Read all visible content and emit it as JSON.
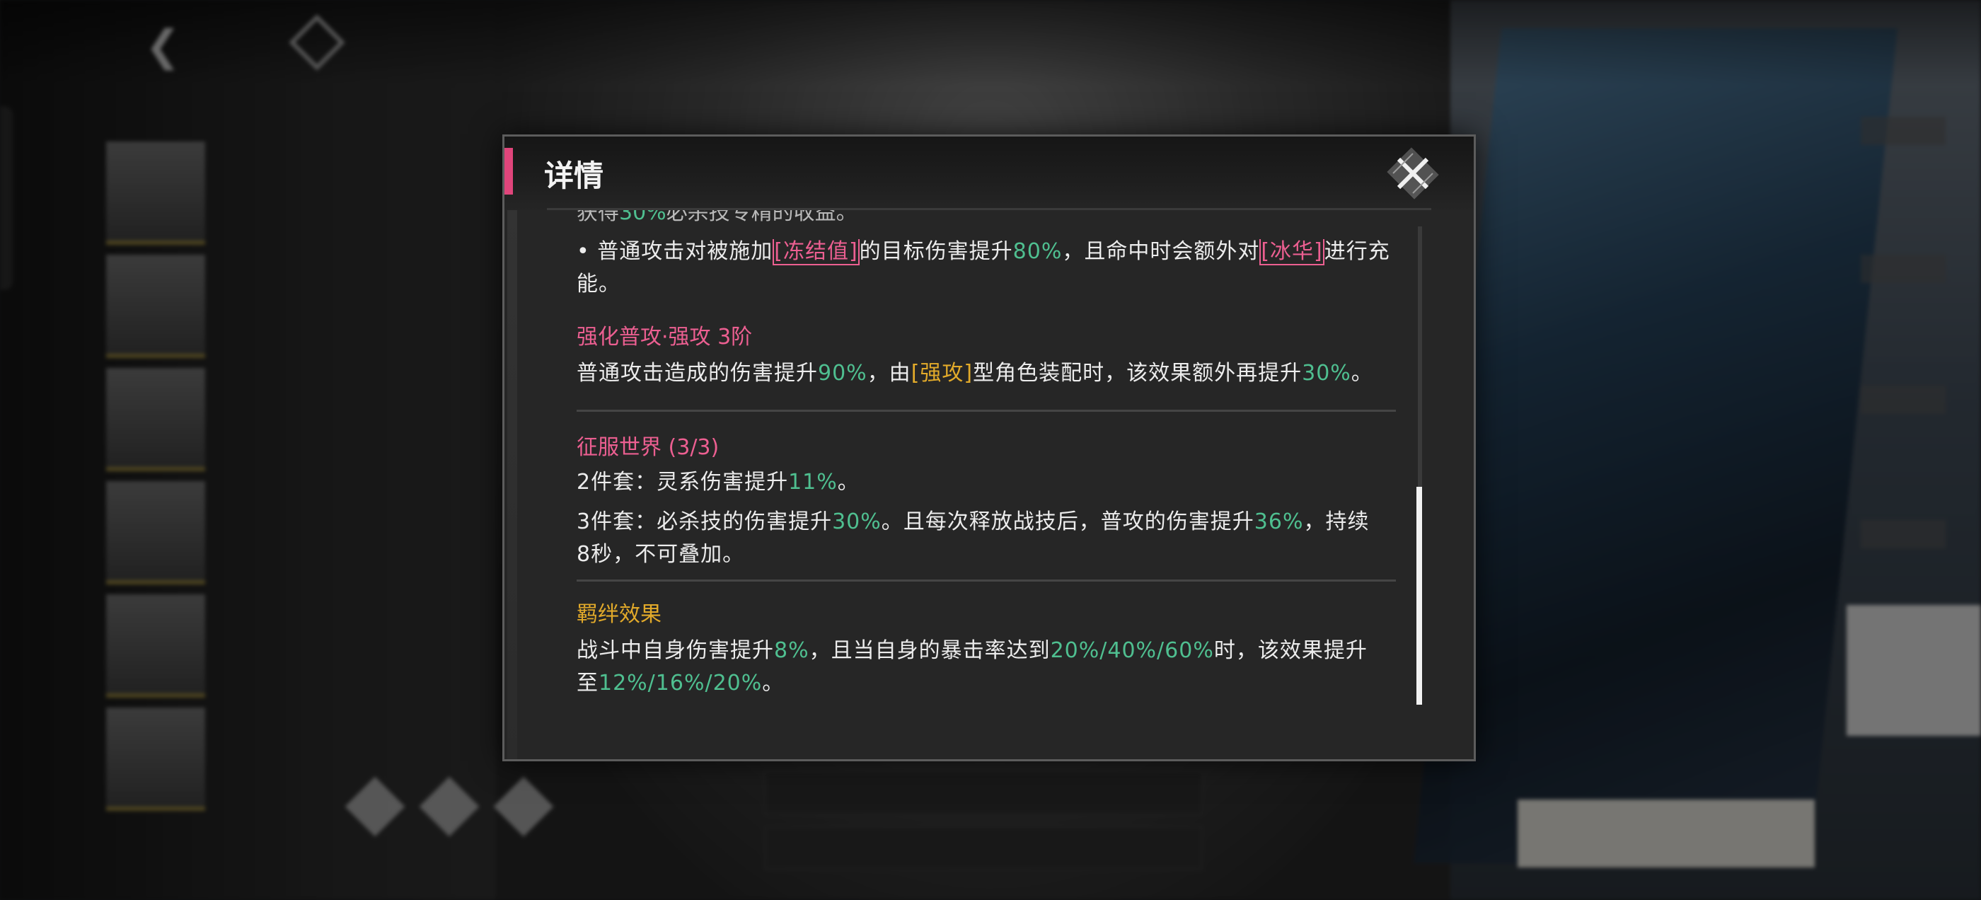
{
  "modal": {
    "title": "详情",
    "top_clipped_line": {
      "prefix": "获得",
      "value": "30%",
      "suffix": "必杀技专精的收益。"
    },
    "bullet_line": {
      "p1": "• 普通攻击对被施加",
      "tag1": "[冻结值]",
      "p2": "的目标伤害提升",
      "value": "80%",
      "p3": "，且命中时会额外对",
      "tag2": "[冰华]",
      "p4": "进行充",
      "p5": "能。"
    },
    "enhance": {
      "title": "强化普攻·强攻 3阶",
      "p1": "普通攻击造成的伤害提升",
      "v1": "90%",
      "p2": "，由",
      "tag": "[强攻]",
      "p3": "型角色装配时，该效果额外再提升",
      "v2": "30%",
      "p4": "。"
    },
    "set": {
      "title": "征服世界 (3/3)",
      "two_piece": {
        "p1": "2件套：灵系伤害提升",
        "v": "11%",
        "p2": "。"
      },
      "three_piece": {
        "p1": "3件套：必杀技的伤害提升",
        "v1": "30%",
        "p2": "。且每次释放战技后，普攻的伤害提升",
        "v2": "36%",
        "p3": "，持续",
        "p4": "8秒，不可叠加。"
      }
    },
    "bond": {
      "title": "羁绊效果",
      "p1": "战斗中自身伤害提升",
      "v1": "8%",
      "p2": "，且当自身的暴击率达到",
      "v2": "20%/40%/60%",
      "p3": "时，该效果提升",
      "p4": "至",
      "v3": "12%/16%/20%",
      "p5": "。"
    }
  },
  "colors": {
    "accent_pink": "#ec5f91",
    "value_green": "#4fbf90",
    "gold": "#e2aa2a",
    "text": "#ececec"
  },
  "icons": {
    "close": "close-x-icon",
    "back": "back-arrow-icon"
  }
}
